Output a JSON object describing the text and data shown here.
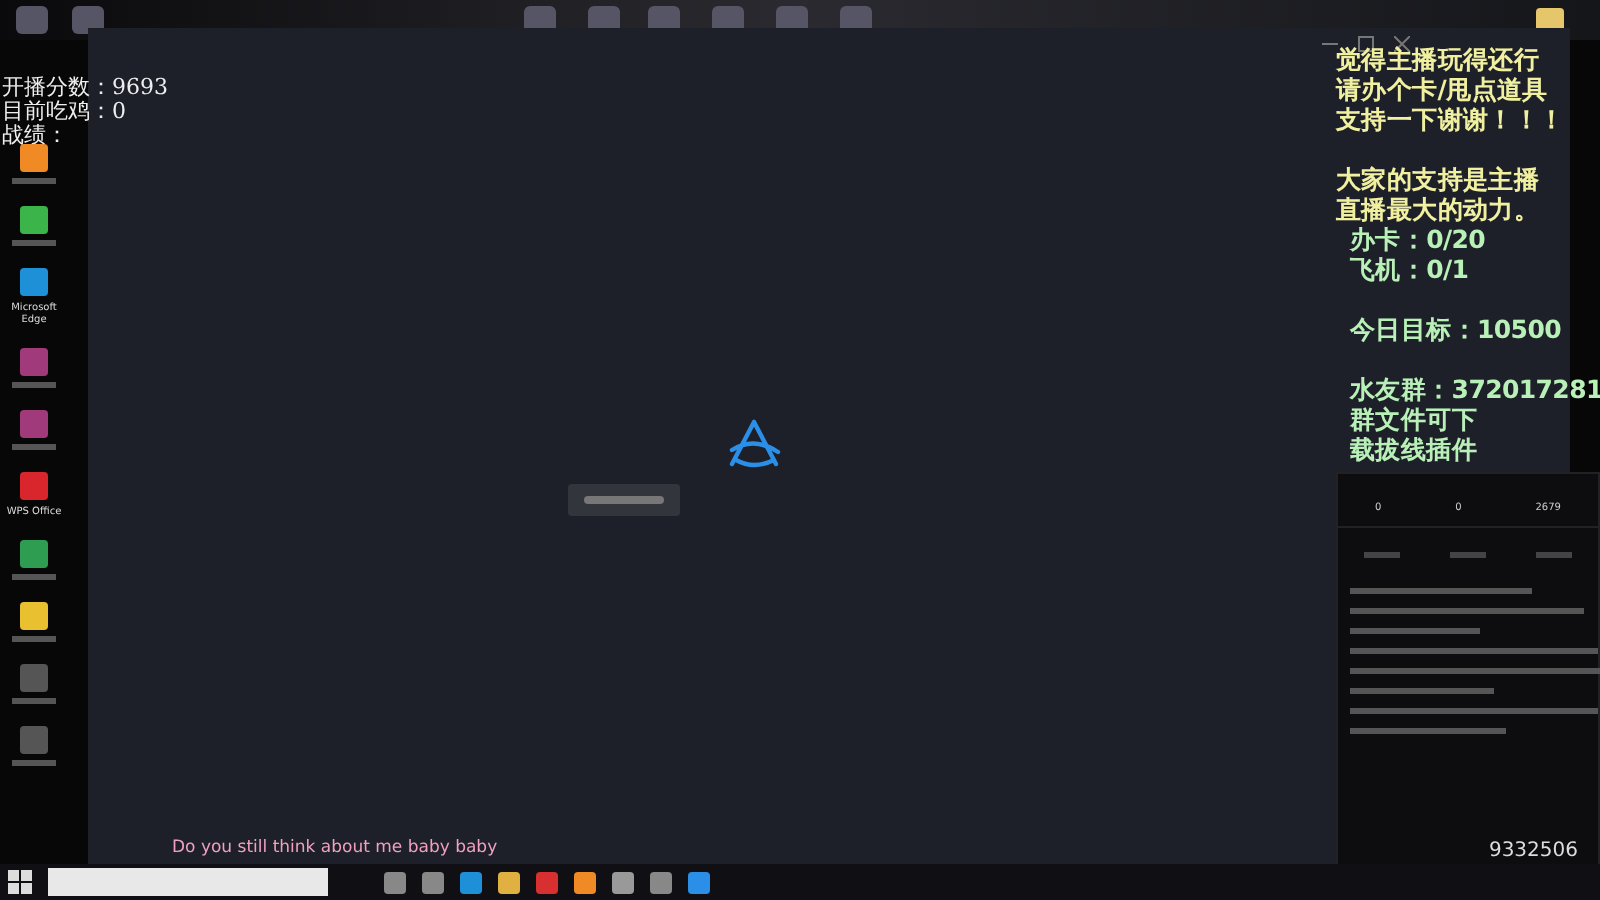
{
  "stats": [
    "开播分数：9693",
    "目前吃鸡：0",
    "战绩："
  ],
  "desktop_icons": [
    {
      "kind": "app"
    },
    {
      "kind": "chat"
    },
    {
      "kind": "edge",
      "label": "Microsoft Edge"
    },
    {
      "kind": "archive"
    },
    {
      "kind": "archive"
    },
    {
      "kind": "wps",
      "label": "WPS Office"
    },
    {
      "kind": "sheet"
    },
    {
      "kind": "game"
    },
    {
      "kind": "video"
    },
    {
      "kind": "video"
    }
  ],
  "overlay": [
    {
      "kind": "notice",
      "text": "觉得主播玩得还行"
    },
    {
      "kind": "notice",
      "text": "请办个卡/甩点道具"
    },
    {
      "kind": "notice",
      "text": "支持一下谢谢！！！"
    },
    {
      "kind": "gap"
    },
    {
      "kind": "notice",
      "text": "大家的支持是主播"
    },
    {
      "kind": "notice",
      "text": "直播最大的动力。"
    },
    {
      "kind": "stat",
      "text": "办卡：0/20"
    },
    {
      "kind": "stat",
      "text": "飞机：0/1"
    },
    {
      "kind": "gap"
    },
    {
      "kind": "stat",
      "text": "今日目标：10500"
    },
    {
      "kind": "gap"
    },
    {
      "kind": "stat",
      "text": "水友群：372017281"
    },
    {
      "kind": "stat",
      "text": "群文件可下"
    },
    {
      "kind": "stat",
      "text": "载拔线插件"
    }
  ],
  "chat_panel": {
    "counts": [
      "0",
      "0",
      "2679"
    ],
    "room_id": "9332506"
  },
  "lyrics": "Do you still think about me baby baby"
}
